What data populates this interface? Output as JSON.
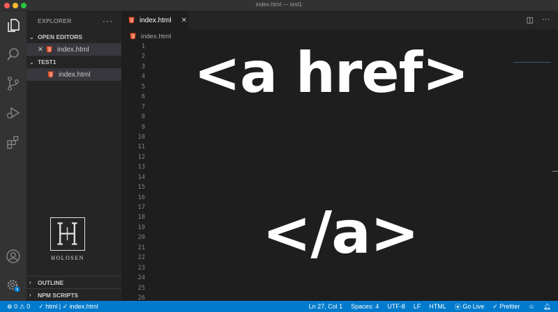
{
  "window": {
    "title": "index.html — test1"
  },
  "explorer": {
    "header": "EXPLORER",
    "more": "···",
    "open_editors_label": "OPEN EDITORS",
    "open_editor_file": "index.html",
    "folder_label": "TEST1",
    "folder_file": "index.html",
    "outline_label": "OUTLINE",
    "npm_label": "NPM SCRIPTS"
  },
  "logo": {
    "text": "HOLOSEN"
  },
  "tab": {
    "label": "index.html"
  },
  "breadcrumb": {
    "file": "index.html"
  },
  "editor": {
    "line_numbers": [
      "1",
      "2",
      "3",
      "4",
      "5",
      "6",
      "7",
      "8",
      "9",
      "10",
      "11",
      "12",
      "13",
      "14",
      "15",
      "16",
      "17",
      "18",
      "19",
      "20",
      "21",
      "22",
      "23",
      "24",
      "25",
      "26"
    ],
    "overlay_open": "<a href>",
    "overlay_close": "</a>"
  },
  "status": {
    "errors": "0",
    "warnings": "0",
    "lint1": "html",
    "lint2": "index.html",
    "position": "Ln 27, Col 1",
    "spaces": "Spaces: 4",
    "encoding": "UTF-8",
    "eol": "LF",
    "language": "HTML",
    "golive": "Go Live",
    "prettier": "Prettier"
  },
  "colors": {
    "accent": "#007acc",
    "html_icon": "#e44d26",
    "sidebar_bg": "#252526",
    "editor_bg": "#1e1e1e"
  }
}
